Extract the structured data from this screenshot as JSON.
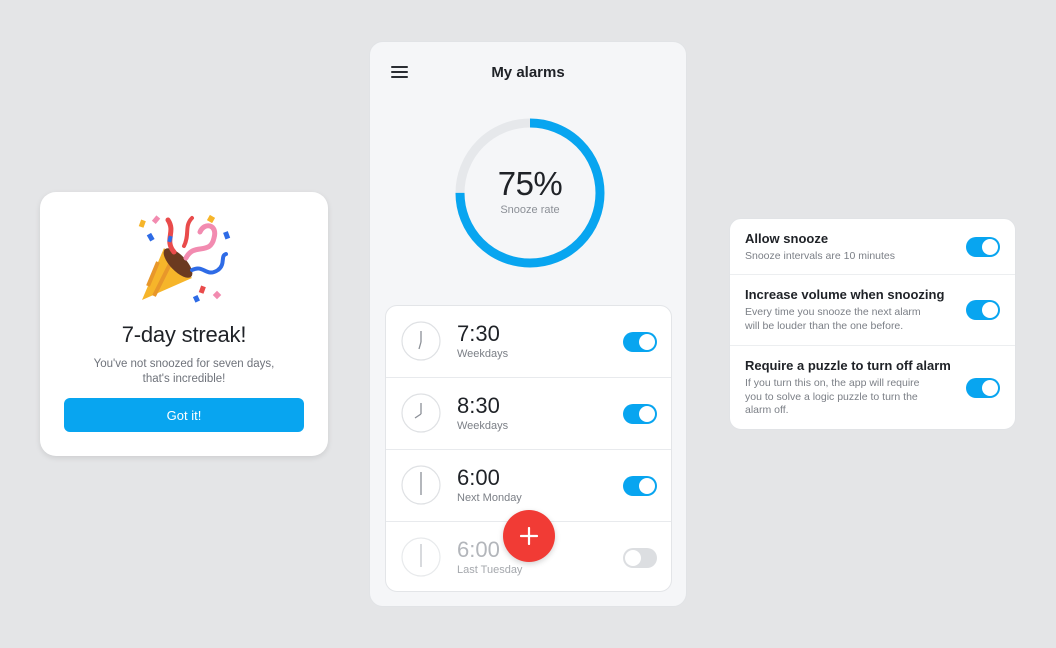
{
  "colors": {
    "accent": "#08a5f0",
    "fab": "#f13b35",
    "background": "#e4e5e7"
  },
  "streak_card": {
    "icon": "party-popper-icon",
    "title": "7-day streak!",
    "text_line1": "You've not snoozed for seven days,",
    "text_line2": "that's incredible!",
    "button_label": "Got it!"
  },
  "phone": {
    "menu_icon": "hamburger-menu-icon",
    "title": "My alarms",
    "snooze_rate": {
      "value_text": "75%",
      "fraction": 0.75,
      "label": "Snooze rate"
    },
    "alarms": [
      {
        "time": "7:30",
        "subtitle": "Weekdays",
        "enabled": true
      },
      {
        "time": "8:30",
        "subtitle": "Weekdays",
        "enabled": true
      },
      {
        "time": "6:00",
        "subtitle": "Next Monday",
        "enabled": true
      },
      {
        "time": "6:00",
        "subtitle": "Last Tuesday",
        "enabled": false
      }
    ],
    "fab_icon": "plus-icon"
  },
  "settings": [
    {
      "title": "Allow snooze",
      "desc_lines": [
        "Snooze intervals are 10 minutes"
      ],
      "enabled": true
    },
    {
      "title": "Increase volume when snoozing",
      "desc_lines": [
        "Every time you snooze the next alarm",
        "will be louder than the one before."
      ],
      "enabled": true
    },
    {
      "title": "Require a puzzle to turn off alarm",
      "desc_lines": [
        "If you turn this on, the app will require",
        "you to solve a logic puzzle to turn the",
        "alarm off."
      ],
      "enabled": true
    }
  ]
}
